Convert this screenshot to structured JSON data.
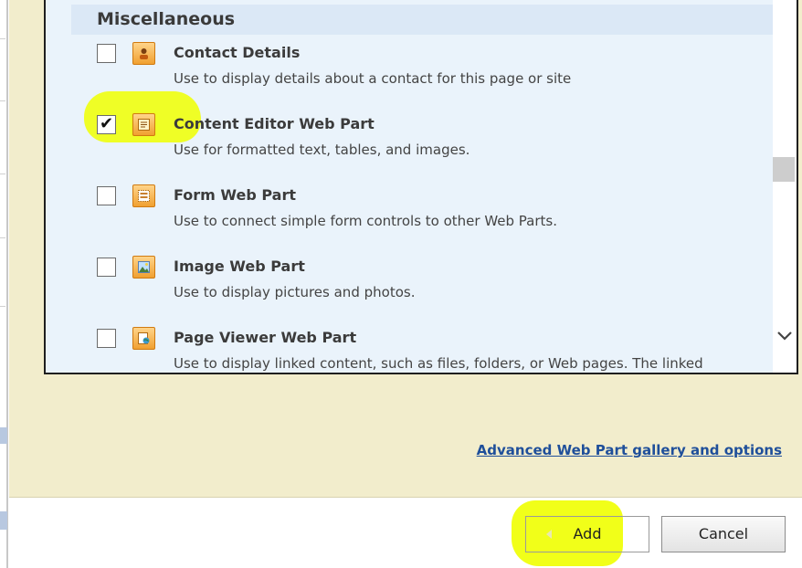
{
  "category": {
    "title": "Miscellaneous"
  },
  "items": [
    {
      "title": "Contact Details",
      "description": "Use to display details about a contact for this page or site",
      "checked": false,
      "icon": "contact-details-icon"
    },
    {
      "title": "Content Editor Web Part",
      "description": "Use for formatted text, tables, and images.",
      "checked": true,
      "icon": "content-editor-icon"
    },
    {
      "title": "Form Web Part",
      "description": "Use to connect simple form controls to other Web Parts.",
      "checked": false,
      "icon": "form-icon"
    },
    {
      "title": "Image Web Part",
      "description": "Use to display pictures and photos.",
      "checked": false,
      "icon": "image-icon"
    },
    {
      "title": "Page Viewer Web Part",
      "description": "Use to display linked content, such as files, folders, or Web pages. The linked",
      "checked": false,
      "icon": "page-viewer-icon"
    }
  ],
  "links": {
    "advanced": "Advanced Web Part gallery and options"
  },
  "buttons": {
    "add": "Add",
    "cancel": "Cancel"
  },
  "check_mark": "✔",
  "colors": {
    "panel": "#f2edcc",
    "list_bg": "#eaf3fb",
    "header_bg": "#dbe8f6",
    "link": "#1f4f9a",
    "highlight": "#f0ff00"
  }
}
